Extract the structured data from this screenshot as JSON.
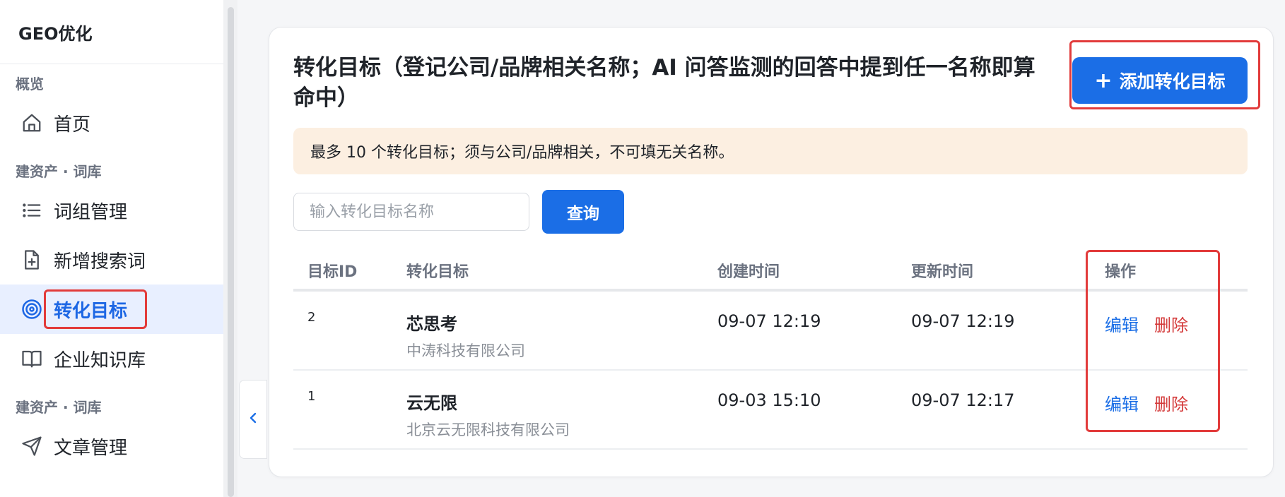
{
  "sidebar": {
    "brand": "GEO优化",
    "groups": [
      {
        "label": "概览"
      },
      {
        "label": "建资产 · 词库"
      },
      {
        "label": "建资产 · 词库"
      }
    ],
    "items": [
      {
        "label": "首页",
        "icon": "home-icon"
      },
      {
        "label": "词组管理",
        "icon": "list-icon"
      },
      {
        "label": "新增搜索词",
        "icon": "file-plus-icon"
      },
      {
        "label": "转化目标",
        "icon": "target-icon",
        "active": true
      },
      {
        "label": "企业知识库",
        "icon": "book-icon"
      },
      {
        "label": "文章管理",
        "icon": "send-icon"
      }
    ]
  },
  "page": {
    "title": "转化目标（登记公司/品牌相关名称；AI 问答监测的回答中提到任一名称即算命中）",
    "add_button": "添加转化目标",
    "notice": "最多 10 个转化目标；须与公司/品牌相关，不可填无关名称。",
    "search": {
      "placeholder": "输入转化目标名称",
      "value": ""
    },
    "query_button": "查询"
  },
  "table": {
    "headers": {
      "id": "目标ID",
      "name": "转化目标",
      "created": "创建时间",
      "updated": "更新时间",
      "ops": "操作"
    },
    "rows": [
      {
        "id": "2",
        "name": "芯思考",
        "company": "中涛科技有限公司",
        "created": "09-07 12:19",
        "updated": "09-07 12:19",
        "edit": "编辑",
        "delete": "删除"
      },
      {
        "id": "1",
        "name": "云无限",
        "company": "北京云无限科技有限公司",
        "created": "09-03 15:10",
        "updated": "09-07 12:17",
        "edit": "编辑",
        "delete": "删除"
      }
    ]
  },
  "colors": {
    "accent": "#1b6ee6",
    "danger": "#d43a3a",
    "highlight_box": "#e23b3b",
    "notice_bg": "#fcefe1",
    "active_nav_bg": "#e8efff"
  }
}
